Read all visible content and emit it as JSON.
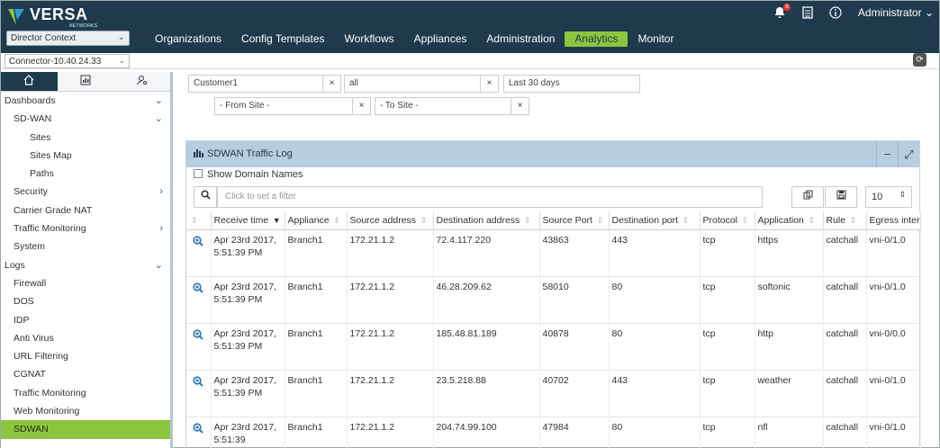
{
  "brand": {
    "name": "VERSA",
    "sub": "NETWORKS"
  },
  "header": {
    "context_select": "Director Context",
    "menu": [
      "Organizations",
      "Config Templates",
      "Workflows",
      "Appliances",
      "Administration",
      "Analytics",
      "Monitor"
    ],
    "active_menu": "Analytics",
    "notifications_count": "9",
    "user": "Administrator"
  },
  "subbar": {
    "connector": "Connector-10.40.24.33"
  },
  "sidebar": {
    "items": [
      {
        "label": "Dashboards",
        "level": 0,
        "arrow": "down"
      },
      {
        "label": "SD-WAN",
        "level": 1,
        "arrow": "down"
      },
      {
        "label": "Sites",
        "level": 2
      },
      {
        "label": "Sites Map",
        "level": 2
      },
      {
        "label": "Paths",
        "level": 2
      },
      {
        "label": "Security",
        "level": 1,
        "arrow": "right"
      },
      {
        "label": "Carrier Grade NAT",
        "level": 1
      },
      {
        "label": "Traffic Monitoring",
        "level": 1,
        "arrow": "right"
      },
      {
        "label": "System",
        "level": 1
      },
      {
        "label": "Logs",
        "level": 0,
        "arrow": "down"
      },
      {
        "label": "Firewall",
        "level": 1
      },
      {
        "label": "DOS",
        "level": 1
      },
      {
        "label": "IDP",
        "level": 1
      },
      {
        "label": "Anti Virus",
        "level": 1
      },
      {
        "label": "URL Filtering",
        "level": 1
      },
      {
        "label": "CGNAT",
        "level": 1
      },
      {
        "label": "Traffic Monitoring",
        "level": 1
      },
      {
        "label": "Web Monitoring",
        "level": 1
      },
      {
        "label": "SDWAN",
        "level": 1,
        "active": true
      }
    ]
  },
  "filters": {
    "organization": "Customer1",
    "scope": "all",
    "time_range": "Last 30 days",
    "from_site": "- From Site -",
    "to_site": "- To Site -"
  },
  "panel": {
    "title": "SDWAN Traffic Log",
    "show_domain_names": "Show Domain Names",
    "search_placeholder": "Click to set a filter",
    "page_size": "10"
  },
  "table": {
    "columns": [
      "Receive time",
      "Appliance",
      "Source address",
      "Destination address",
      "Source Port",
      "Destination port",
      "Protocol",
      "Application",
      "Rule",
      "Egress interface"
    ],
    "rows": [
      {
        "time": "Apr 23rd 2017, 5:51:39 PM",
        "appliance": "Branch1",
        "src": "172.21.1.2",
        "dst": "72.4.117.220",
        "sport": "43863",
        "dport": "443",
        "proto": "tcp",
        "app": "https",
        "rule": "catchall",
        "egress": "vni-0/1.0"
      },
      {
        "time": "Apr 23rd 2017, 5:51:39 PM",
        "appliance": "Branch1",
        "src": "172.21.1.2",
        "dst": "46.28.209.62",
        "sport": "58010",
        "dport": "80",
        "proto": "tcp",
        "app": "softonic",
        "rule": "catchall",
        "egress": "vni-0/1.0"
      },
      {
        "time": "Apr 23rd 2017, 5:51:39 PM",
        "appliance": "Branch1",
        "src": "172.21.1.2",
        "dst": "185.48.81.189",
        "sport": "40878",
        "dport": "80",
        "proto": "tcp",
        "app": "http",
        "rule": "catchall",
        "egress": "vni-0/0.0"
      },
      {
        "time": "Apr 23rd 2017, 5:51:39 PM",
        "appliance": "Branch1",
        "src": "172.21.1.2",
        "dst": "23.5.218.88",
        "sport": "40702",
        "dport": "443",
        "proto": "tcp",
        "app": "weather",
        "rule": "catchall",
        "egress": "vni-0/1.0"
      },
      {
        "time": "Apr 23rd 2017, 5:51:39",
        "appliance": "Branch1",
        "src": "172.21.1.2",
        "dst": "204.74.99.100",
        "sport": "47984",
        "dport": "80",
        "proto": "tcp",
        "app": "nfl",
        "rule": "catchall",
        "egress": "vni-0/1.0"
      }
    ]
  },
  "colors": {
    "nav_bg": "#1e3a4c",
    "accent_green": "#8cc63f",
    "panel_head": "#b7cde0"
  }
}
